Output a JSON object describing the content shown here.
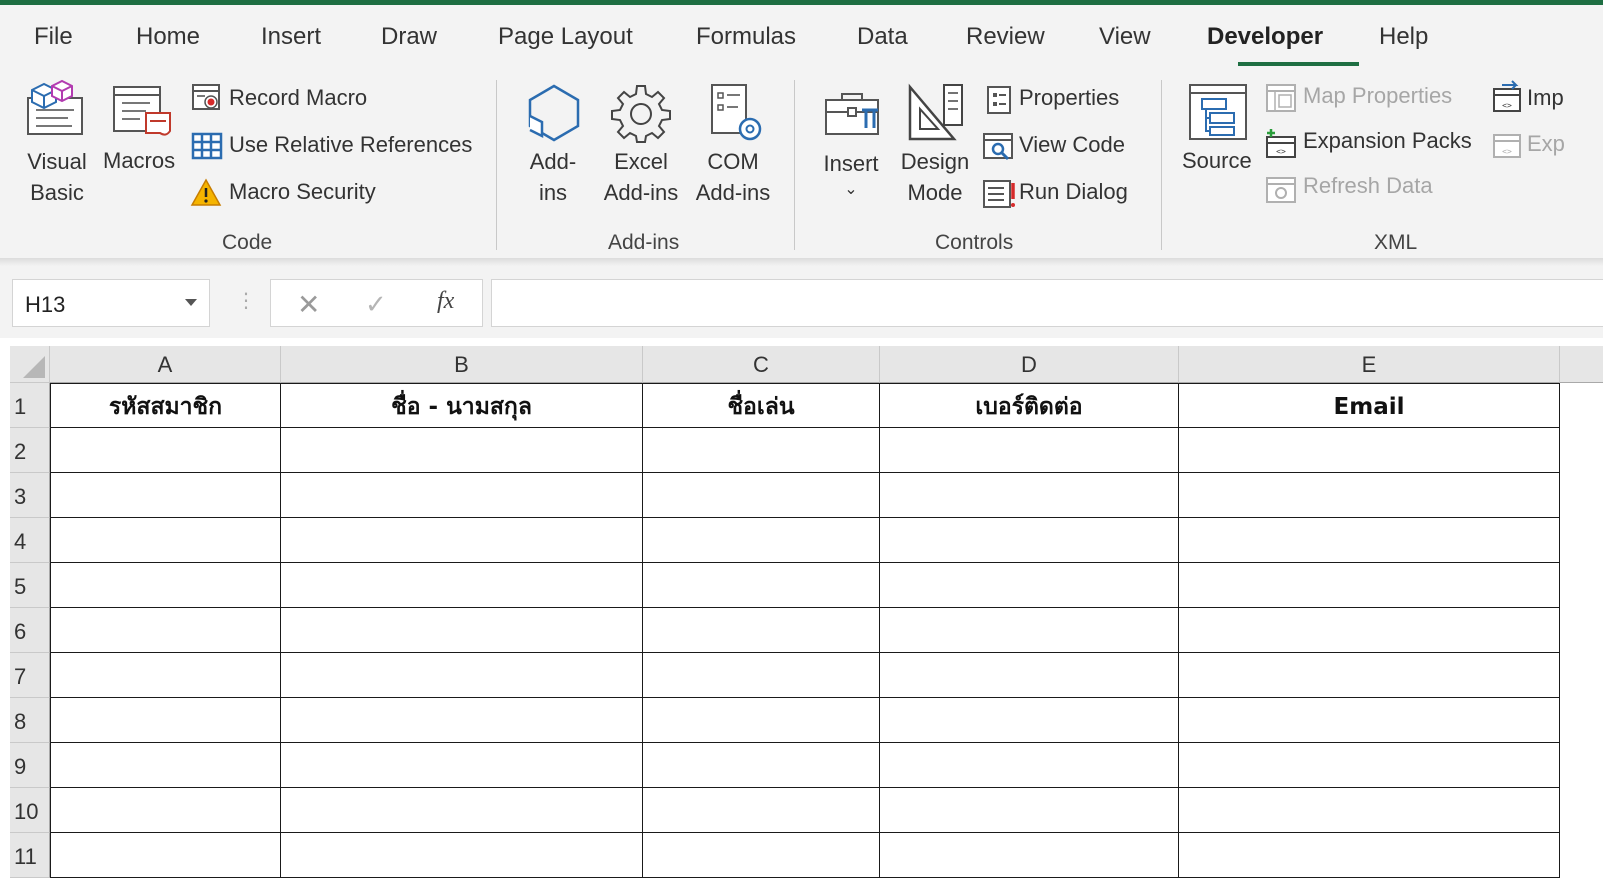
{
  "ribbon": {
    "tabs": [
      "File",
      "Home",
      "Insert",
      "Draw",
      "Page Layout",
      "Formulas",
      "Data",
      "Review",
      "View",
      "Developer",
      "Help"
    ],
    "active_tab": "Developer",
    "code": {
      "visual_basic": [
        "Visual",
        "Basic"
      ],
      "macros": "Macros",
      "record_macro": "Record Macro",
      "use_relative": "Use Relative References",
      "macro_security": "Macro Security",
      "label": "Code"
    },
    "addins": {
      "addins": [
        "Add-",
        "ins"
      ],
      "excel_addins": [
        "Excel",
        "Add-ins"
      ],
      "com_addins": [
        "COM",
        "Add-ins"
      ],
      "label": "Add-ins"
    },
    "controls": {
      "insert": "Insert",
      "insert_caret": "⌄",
      "design_mode": [
        "Design",
        "Mode"
      ],
      "properties": "Properties",
      "view_code": "View Code",
      "run_dialog": "Run Dialog",
      "label": "Controls"
    },
    "xml": {
      "source": "Source",
      "map_properties": "Map Properties",
      "expansion_packs": "Expansion Packs",
      "refresh_data": "Refresh Data",
      "import": "Imp",
      "export": "Exp",
      "label": "XML"
    }
  },
  "formula_bar": {
    "name_box": "H13",
    "separator": "⋮",
    "cancel": "✕",
    "enter": "✓",
    "fx": "fx",
    "formula": ""
  },
  "sheet": {
    "columns": [
      "A",
      "B",
      "C",
      "D",
      "E"
    ],
    "rows": [
      "1",
      "2",
      "3",
      "4",
      "5",
      "6",
      "7",
      "8",
      "9",
      "10",
      "11"
    ],
    "headers": [
      "รหัสสมาชิก",
      "ชื่อ - นามสกุล",
      "ชื่อเล่น",
      "เบอร์ติดต่อ",
      "Email"
    ]
  },
  "colors": {
    "accent": "#1e6e42",
    "ribbon_bg": "#f3f3f3",
    "header_bg": "#e6e6e6",
    "warning": "#e8a000",
    "icon_blue": "#2b6cb0"
  }
}
